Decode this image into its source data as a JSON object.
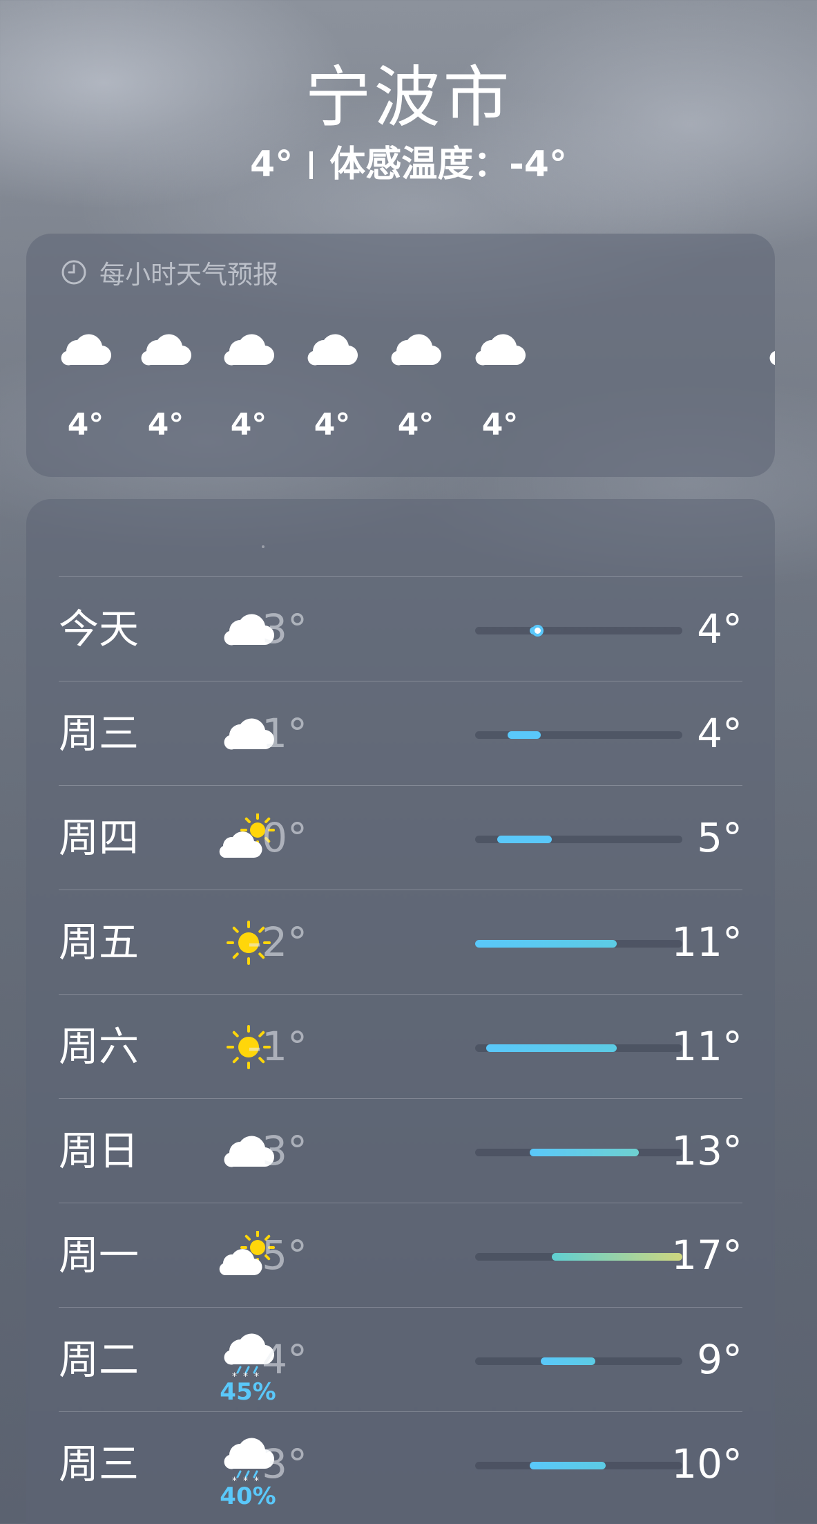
{
  "header": {
    "city": "宁波市",
    "current_temp": "4°",
    "feels_like": "体感温度：-4°"
  },
  "hourly": {
    "title": "每小时天气预报",
    "items": [
      {
        "icon": "cloud-icon",
        "temp": "4°"
      },
      {
        "icon": "cloud-icon",
        "temp": "4°"
      },
      {
        "icon": "cloud-icon",
        "temp": "4°"
      },
      {
        "icon": "cloud-icon",
        "temp": "4°"
      },
      {
        "icon": "cloud-icon",
        "temp": "4°"
      },
      {
        "icon": "cloud-icon",
        "temp": "4°"
      }
    ]
  },
  "daily": {
    "range_min": -2,
    "range_max": 17,
    "days": [
      {
        "day": "今天",
        "icon": "cloud-icon",
        "low": "3°",
        "high": "4°",
        "low_val": 3,
        "high_val": 4,
        "current_val": 3.3,
        "precip": "",
        "bar_colors": [
          "#5ac8fa",
          "#5ac8fa"
        ]
      },
      {
        "day": "周三",
        "icon": "cloud-icon",
        "low": "1°",
        "high": "4°",
        "low_val": 1,
        "high_val": 4,
        "precip": "",
        "bar_colors": [
          "#5ac8fa",
          "#5ac8fa"
        ]
      },
      {
        "day": "周四",
        "icon": "partly-sunny-icon",
        "low": "0°",
        "high": "5°",
        "low_val": 0,
        "high_val": 5,
        "precip": "",
        "bar_colors": [
          "#5ac8fa",
          "#5ac8fa"
        ]
      },
      {
        "day": "周五",
        "icon": "sun-icon",
        "low": "-2°",
        "high": "11°",
        "low_val": -2,
        "high_val": 11,
        "precip": "",
        "bar_colors": [
          "#5ac8fa",
          "#5ccbe4"
        ]
      },
      {
        "day": "周六",
        "icon": "sun-icon",
        "low": "-1°",
        "high": "11°",
        "low_val": -1,
        "high_val": 11,
        "precip": "",
        "bar_colors": [
          "#5ac8fa",
          "#5ccbe4"
        ]
      },
      {
        "day": "周日",
        "icon": "cloud-icon",
        "low": "3°",
        "high": "13°",
        "low_val": 3,
        "high_val": 13,
        "precip": "",
        "bar_colors": [
          "#5ac8fa",
          "#6ed0d0"
        ]
      },
      {
        "day": "周一",
        "icon": "partly-sunny-icon",
        "low": "5°",
        "high": "17°",
        "low_val": 5,
        "high_val": 17,
        "precip": "",
        "bar_colors": [
          "#5fcfd2",
          "#cfd67e"
        ]
      },
      {
        "day": "周二",
        "icon": "snow-cloud-icon",
        "low": "4°",
        "high": "9°",
        "low_val": 4,
        "high_val": 9,
        "precip": "45%",
        "bar_colors": [
          "#5ac8fa",
          "#5ccbe4"
        ]
      },
      {
        "day": "周三",
        "icon": "snow-cloud-icon",
        "low": "3°",
        "high": "10°",
        "low_val": 3,
        "high_val": 10,
        "precip": "40%",
        "bar_colors": [
          "#5ac8fa",
          "#5ccbe4"
        ]
      }
    ]
  }
}
